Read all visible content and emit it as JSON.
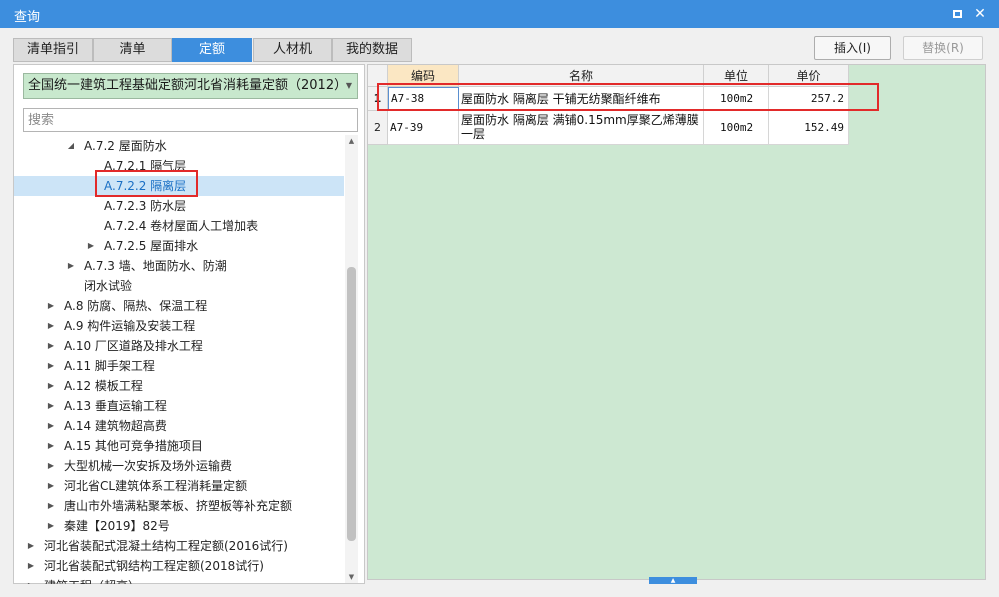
{
  "window": {
    "title": "查询"
  },
  "tabs": [
    {
      "label": "清单指引",
      "active": false
    },
    {
      "label": "清单",
      "active": false
    },
    {
      "label": "定额",
      "active": true
    },
    {
      "label": "人材机",
      "active": false
    },
    {
      "label": "我的数据",
      "active": false
    }
  ],
  "toolbar": {
    "insert_label": "插入(I)",
    "replace_label": "替换(R)"
  },
  "library_select": {
    "value": "全国统一建筑工程基础定额河北省消耗量定额（2012）"
  },
  "search": {
    "placeholder": "搜索"
  },
  "tree": [
    {
      "label": "A.7.2 屋面防水",
      "expander": "expanded",
      "selected": false
    },
    {
      "label": "A.7.2.1 隔气层",
      "expander": "none",
      "selected": false
    },
    {
      "label": "A.7.2.2 隔离层",
      "expander": "none",
      "selected": true
    },
    {
      "label": "A.7.2.3 防水层",
      "expander": "none",
      "selected": false
    },
    {
      "label": "A.7.2.4 卷材屋面人工增加表",
      "expander": "none",
      "selected": false
    },
    {
      "label": "A.7.2.5 屋面排水",
      "expander": "collapsed",
      "selected": false
    },
    {
      "label": "A.7.3 墙、地面防水、防潮",
      "expander": "collapsed",
      "selected": false
    },
    {
      "label": "闭水试验",
      "expander": "none",
      "selected": false
    },
    {
      "label": "A.8 防腐、隔热、保温工程",
      "expander": "collapsed",
      "selected": false
    },
    {
      "label": "A.9 构件运输及安装工程",
      "expander": "collapsed",
      "selected": false
    },
    {
      "label": "A.10 厂区道路及排水工程",
      "expander": "collapsed",
      "selected": false
    },
    {
      "label": "A.11 脚手架工程",
      "expander": "collapsed",
      "selected": false
    },
    {
      "label": "A.12 模板工程",
      "expander": "collapsed",
      "selected": false
    },
    {
      "label": "A.13 垂直运输工程",
      "expander": "collapsed",
      "selected": false
    },
    {
      "label": "A.14 建筑物超高费",
      "expander": "collapsed",
      "selected": false
    },
    {
      "label": "A.15 其他可竞争措施项目",
      "expander": "collapsed",
      "selected": false
    },
    {
      "label": "大型机械一次安拆及场外运输费",
      "expander": "collapsed",
      "selected": false
    },
    {
      "label": "河北省CL建筑体系工程消耗量定额",
      "expander": "collapsed",
      "selected": false
    },
    {
      "label": "唐山市外墙满粘聚苯板、挤塑板等补充定额",
      "expander": "collapsed",
      "selected": false
    },
    {
      "label": "秦建【2019】82号",
      "expander": "collapsed",
      "selected": false
    },
    {
      "label": "河北省装配式混凝土结构工程定额(2016试行)",
      "expander": "collapsed",
      "selected": false
    },
    {
      "label": "河北省装配式钢结构工程定额(2018试行)",
      "expander": "collapsed",
      "selected": false
    },
    {
      "label": "建筑工程（超高）",
      "expander": "collapsed",
      "selected": false
    }
  ],
  "table": {
    "columns": [
      "编码",
      "名称",
      "单位",
      "单价"
    ],
    "rows": [
      {
        "num": "1",
        "code": "A7-38",
        "name": "屋面防水 隔离层 干铺无纺聚酯纤维布",
        "unit": "100m2",
        "price": "257.2"
      },
      {
        "num": "2",
        "code": "A7-39",
        "name": "屋面防水 隔离层 满铺0.15mm厚聚乙烯薄膜一层",
        "unit": "100m2",
        "price": "152.49"
      }
    ]
  },
  "colors": {
    "title_bar": "#3d8ede",
    "active_tab": "#3d8ede",
    "grid_background": "#cde8d2",
    "selected_tree_item": "#cce4f7",
    "highlight_box": "#e22a2a"
  }
}
